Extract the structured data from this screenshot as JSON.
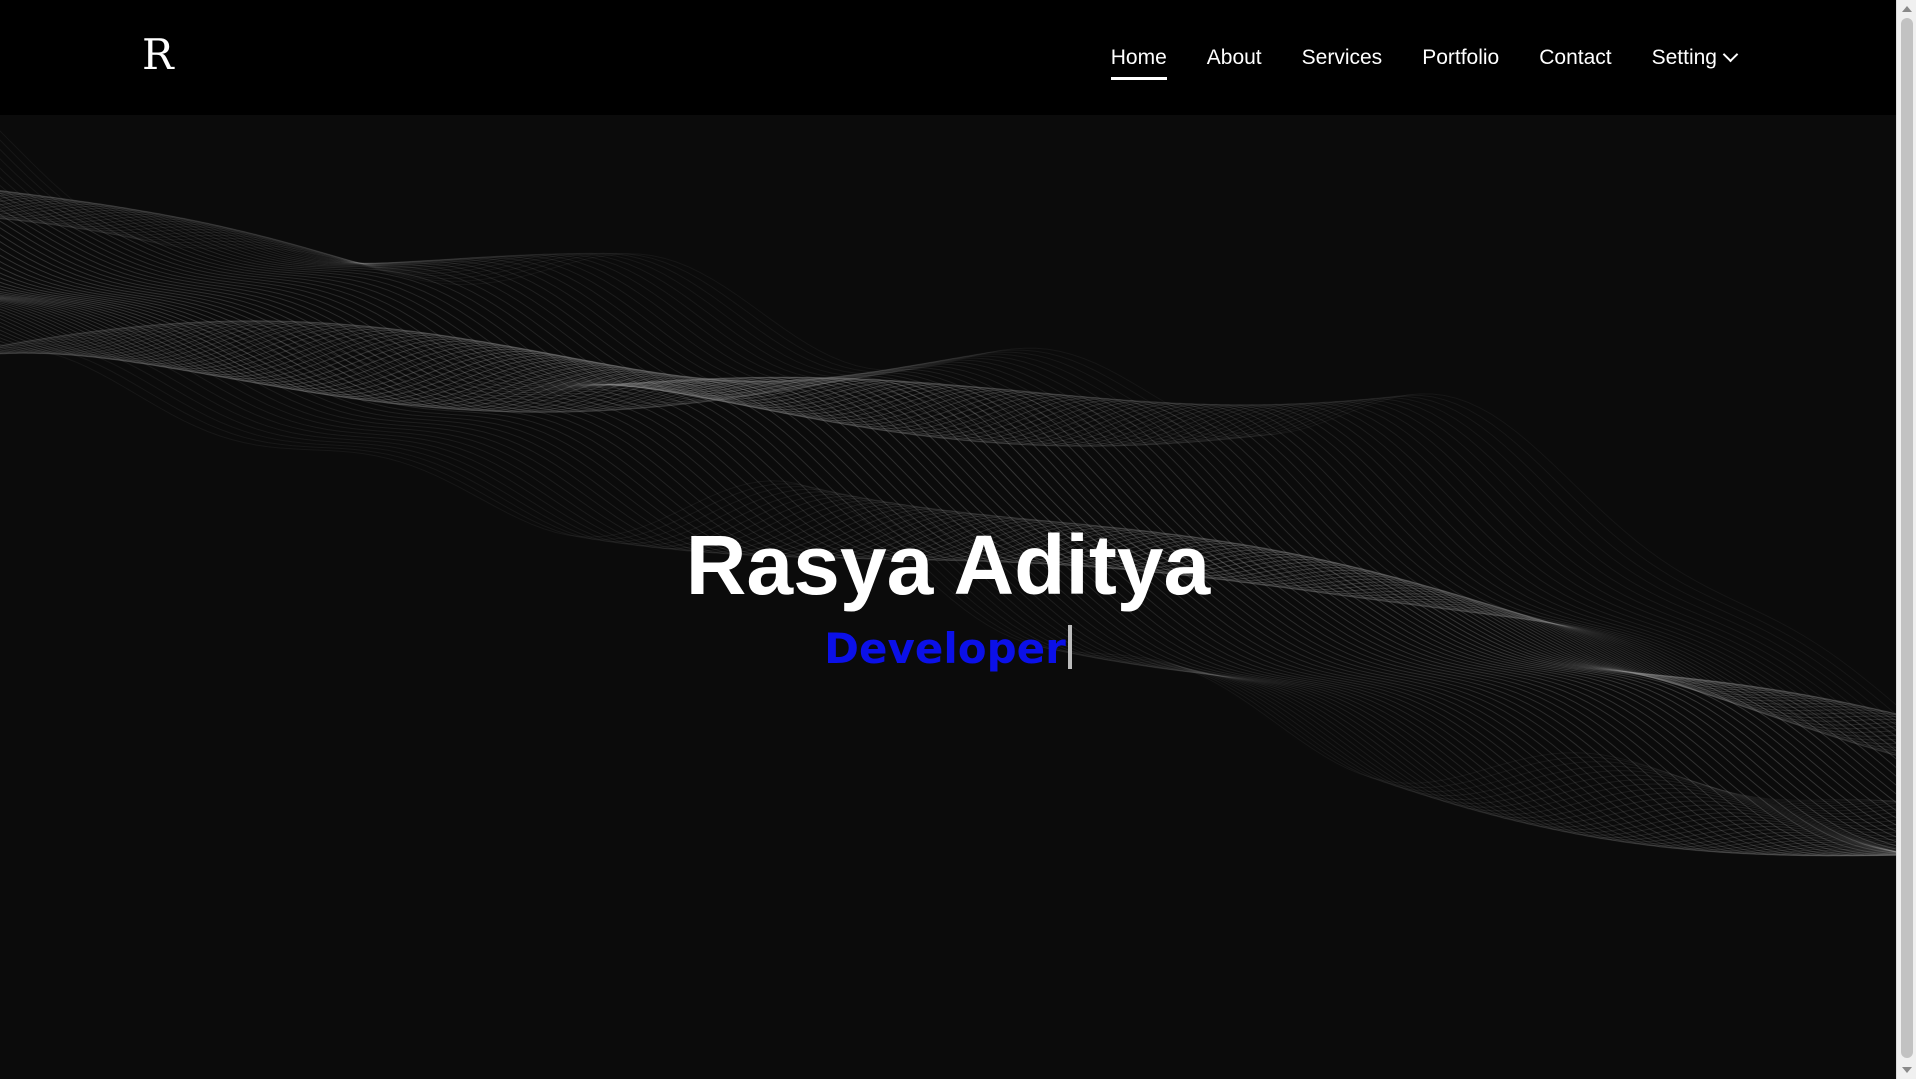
{
  "header": {
    "logo": "R",
    "nav": [
      {
        "label": "Home",
        "active": true
      },
      {
        "label": "About",
        "active": false
      },
      {
        "label": "Services",
        "active": false
      },
      {
        "label": "Portfolio",
        "active": false
      },
      {
        "label": "Contact",
        "active": false
      },
      {
        "label": "Setting",
        "active": false,
        "dropdown": true
      }
    ]
  },
  "hero": {
    "name": "Rasya Aditya",
    "role": "Developer",
    "role_color": "#0b10e8",
    "background": "particle-wave"
  },
  "colors": {
    "background": "#0b0b0b",
    "header": "#000000",
    "text": "#ffffff",
    "wave": "#9a9a9a"
  }
}
